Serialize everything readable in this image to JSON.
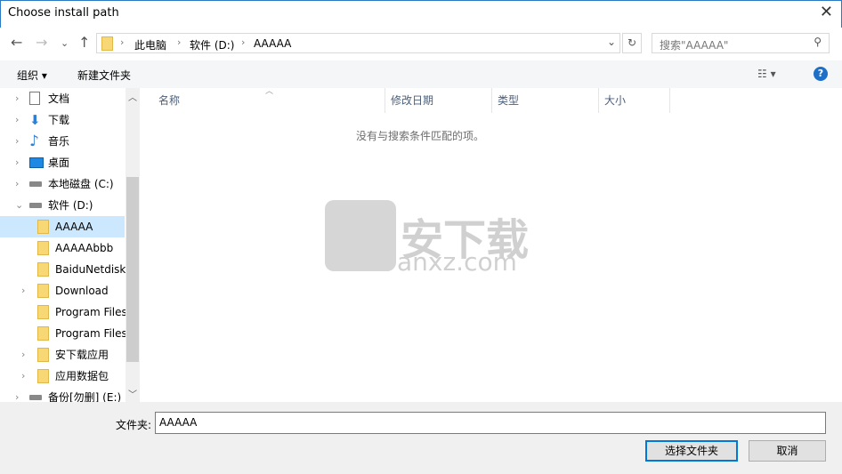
{
  "window": {
    "title": "Choose install path",
    "close": "✕"
  },
  "nav": {
    "back": "←",
    "forward": "→",
    "recent": "⌄",
    "up": "↑"
  },
  "address": {
    "crumbs": [
      "此电脑",
      "软件 (D:)",
      "AAAAA"
    ],
    "sep": "›",
    "dropdown": "⌄",
    "refresh": "↻"
  },
  "search": {
    "placeholder": "搜索\"AAAAA\"",
    "icon": "⚲"
  },
  "toolbar": {
    "organize": "组织 ▾",
    "new_folder": "新建文件夹",
    "view": "☷ ▾",
    "help": "?"
  },
  "tree": [
    {
      "label": "文档",
      "icon": "document-icon",
      "chev": "›"
    },
    {
      "label": "下载",
      "icon": "download-icon",
      "chev": "›"
    },
    {
      "label": "音乐",
      "icon": "music-icon",
      "chev": "›"
    },
    {
      "label": "桌面",
      "icon": "desktop-icon",
      "chev": "›"
    },
    {
      "label": "本地磁盘 (C:)",
      "icon": "drive-icon",
      "chev": "›"
    },
    {
      "label": "软件 (D:)",
      "icon": "drive-icon",
      "chev": "⌄"
    },
    {
      "label": "AAAAA",
      "icon": "folder-icon",
      "chev": "",
      "selected": true
    },
    {
      "label": "AAAAAbbb",
      "icon": "folder-icon",
      "chev": ""
    },
    {
      "label": "BaiduNetdisk",
      "icon": "folder-icon",
      "chev": ""
    },
    {
      "label": "Download",
      "icon": "folder-icon",
      "chev": "›"
    },
    {
      "label": "Program Files",
      "icon": "folder-icon",
      "chev": ""
    },
    {
      "label": "Program Files",
      "icon": "folder-icon",
      "chev": ""
    },
    {
      "label": "安下载应用",
      "icon": "folder-icon",
      "chev": "›"
    },
    {
      "label": "应用数据包",
      "icon": "folder-icon",
      "chev": "›"
    },
    {
      "label": "备份[勿删] (E:)",
      "icon": "drive-icon",
      "chev": "›"
    }
  ],
  "columns": [
    "名称",
    "修改日期",
    "类型",
    "大小"
  ],
  "empty_message": "没有与搜索条件匹配的项。",
  "watermark": {
    "text": "安下载",
    "url": "anxz.com"
  },
  "footer": {
    "folder_label": "文件夹:",
    "folder_value": "AAAAA",
    "select": "选择文件夹",
    "cancel": "取消"
  }
}
